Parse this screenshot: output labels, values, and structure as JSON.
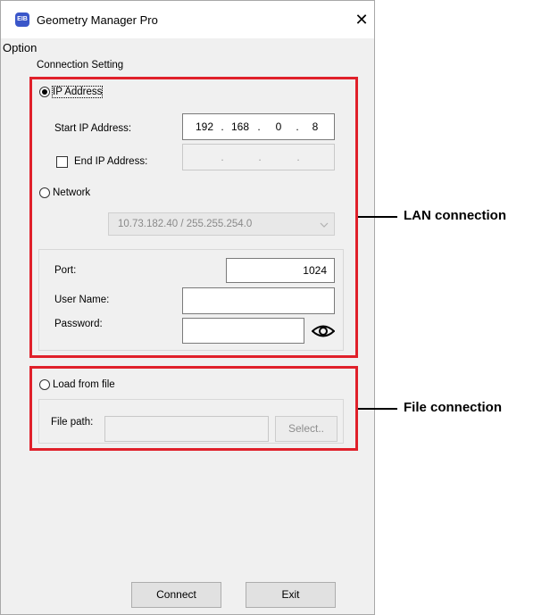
{
  "window": {
    "title": "Geometry Manager Pro",
    "icon": "app-logo-icon",
    "close_glyph": "✕"
  },
  "menu": {
    "option": "Option"
  },
  "connection": {
    "group_title": "Connection Setting",
    "ip_address_label": "IP Address",
    "ip_address_selected": true,
    "start_ip_label": "Start IP Address:",
    "start_ip": [
      "192",
      "168",
      "0",
      "8"
    ],
    "end_ip_label": "End IP Address:",
    "end_ip_checked": false,
    "network_label": "Network",
    "network_value": "10.73.182.40 / 255.255.254.0",
    "port_label": "Port:",
    "port_value": "1024",
    "username_label": "User Name:",
    "username_value": "",
    "password_label": "Password:",
    "password_value": "",
    "load_from_file_label": "Load from file",
    "file_path_label": "File path:",
    "file_path_value": "",
    "select_button": "Select.."
  },
  "buttons": {
    "connect": "Connect",
    "exit": "Exit"
  },
  "callouts": {
    "lan": "LAN connection",
    "file": "File connection"
  },
  "colors": {
    "highlight_box": "#e0202a",
    "window_bg": "#f0f0f0"
  }
}
